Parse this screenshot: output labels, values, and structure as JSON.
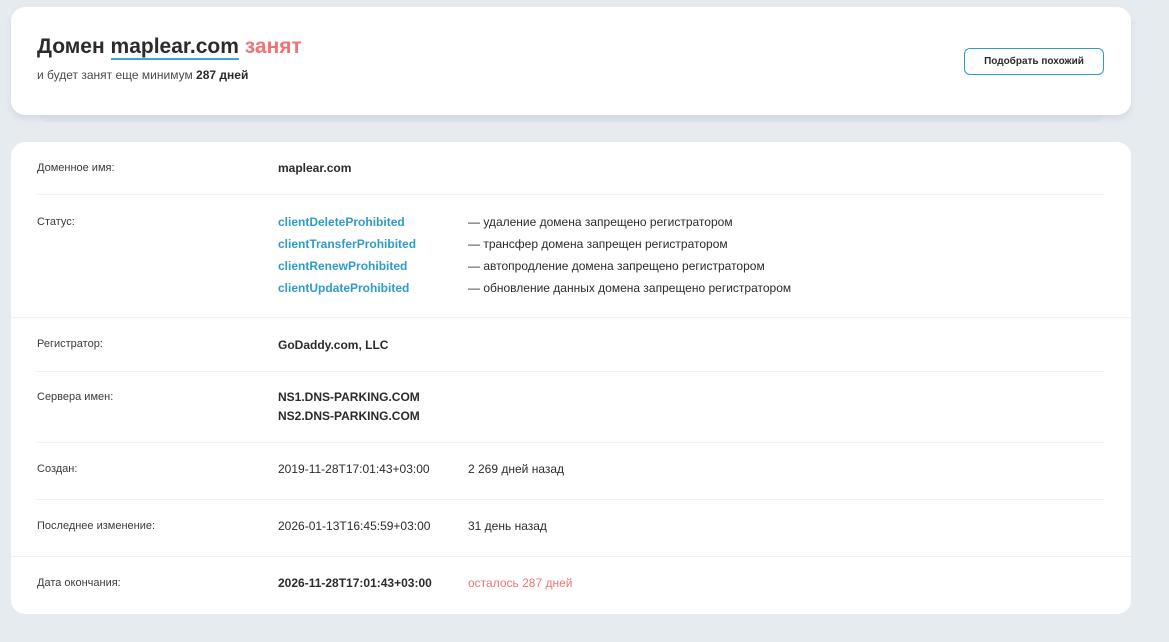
{
  "header": {
    "title_prefix": "Домен",
    "domain": "maplear.com",
    "status_word": "занят",
    "subtitle_prefix": "и будет занят еще минимум",
    "subtitle_days": "287 дней",
    "similar_button_label": "Подобрать похожий"
  },
  "details": {
    "domain_name": {
      "label": "Доменное имя:",
      "value": "maplear.com"
    },
    "status": {
      "label": "Статус:",
      "items": [
        {
          "code": "clientDeleteProhibited",
          "description": "— удаление домена запрещено регистратором"
        },
        {
          "code": "clientTransferProhibited",
          "description": "— трансфер домена запрещен регистратором"
        },
        {
          "code": "clientRenewProhibited",
          "description": "— автопродление домена запрещено регистратором"
        },
        {
          "code": "clientUpdateProhibited",
          "description": "— обновление данных домена запрещено регистратором"
        }
      ]
    },
    "registrar": {
      "label": "Регистратор:",
      "value": "GoDaddy.com, LLC"
    },
    "nameservers": {
      "label": "Сервера имен:",
      "values": [
        "NS1.DNS-PARKING.COM",
        "NS2.DNS-PARKING.COM"
      ]
    },
    "created": {
      "label": "Создан:",
      "value": "2019-11-28T17:01:43+03:00",
      "relative": "2 269 дней назад"
    },
    "updated": {
      "label": "Последнее изменение:",
      "value": "2026-01-13T16:45:59+03:00",
      "relative": "31 день назад"
    },
    "expires": {
      "label": "Дата окончания:",
      "value": "2026-11-28T17:01:43+03:00",
      "relative": "осталось 287 дней"
    }
  },
  "colors": {
    "background": "#e6ebf0",
    "accent": "#2f9bc7",
    "busy_red": "#f07373",
    "text": "#2b2b2b"
  }
}
